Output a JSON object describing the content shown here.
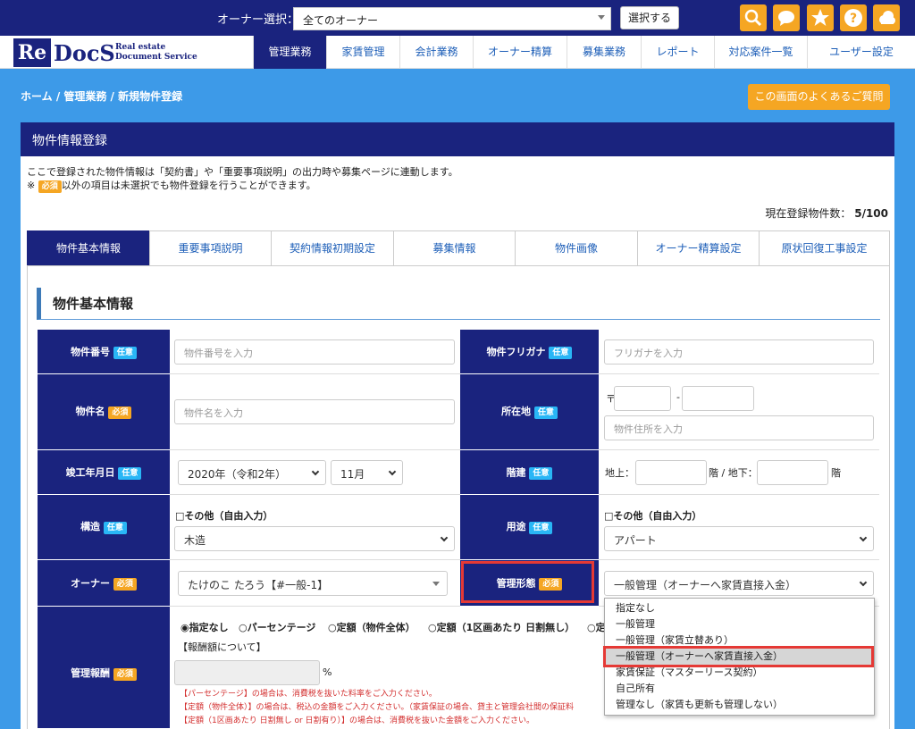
{
  "topbar": {
    "owner_label": "オーナー選択：",
    "owner_value": "全てのオーナー",
    "select_button": "選択する",
    "icons": [
      "search-icon",
      "chat-icon",
      "star-icon",
      "help-icon",
      "cloud-icon"
    ]
  },
  "logo": {
    "mark": "Re",
    "name": "DocS",
    "sub1": "Real estate",
    "sub2": "Document Service"
  },
  "nav": [
    "管理業務",
    "家賃管理",
    "会計業務",
    "オーナー精算",
    "募集業務",
    "レポート",
    "対応案件一覧",
    "ユーザー設定"
  ],
  "breadcrumb": "ホーム / 管理業務 / 新規物件登録",
  "faq_button": "この画面のよくあるご質問",
  "panel": {
    "title": "物件情報登録",
    "desc1": "ここで登録された物件情報は「契約書」や「重要事項説明」の出力時や募集ページに連動します。",
    "desc2_prefix": "※",
    "desc2_badge": "必須",
    "desc2_suffix": "以外の項目は未選択でも物件登録を行うことができます。",
    "count_label": "現在登録物件数：",
    "count_value": "5/100"
  },
  "tabs": [
    "物件基本情報",
    "重要事項説明",
    "契約情報初期設定",
    "募集情報",
    "物件画像",
    "オーナー精算設定",
    "原状回復工事設定"
  ],
  "section_title": "物件基本情報",
  "badges": {
    "required": "必須",
    "optional": "任意"
  },
  "fields": {
    "number": {
      "label": "物件番号",
      "placeholder": "物件番号を入力"
    },
    "kana": {
      "label": "物件フリガナ",
      "placeholder": "フリガナを入力"
    },
    "name": {
      "label": "物件名",
      "placeholder": "物件名を入力"
    },
    "address": {
      "label": "所在地",
      "postal_mark": "〒",
      "dash": "-",
      "placeholder": "物件住所を入力"
    },
    "built": {
      "label": "竣工年月日",
      "year": "2020年（令和2年）",
      "month": "11月"
    },
    "floors": {
      "label": "階建",
      "above": "地上：",
      "mid": "階 / 地下：",
      "end": "階"
    },
    "structure": {
      "label": "構造",
      "other": "□その他（自由入力）",
      "value": "木造"
    },
    "usage": {
      "label": "用途",
      "other": "□その他（自由入力）",
      "value": "アパート"
    },
    "owner": {
      "label": "オーナー",
      "value": "たけのこ たろう【#一般-1】"
    },
    "mgmt_type": {
      "label": "管理形態",
      "value": "一般管理（オーナーへ家賃直接入金）"
    },
    "fee": {
      "label": "管理報酬",
      "options": [
        "◉指定なし",
        "○パーセンテージ",
        "○定額（物件全体）",
        "○定額（1区画あたり 日割無し）",
        "○定"
      ],
      "note_label": "【報酬額について】",
      "unit": "%",
      "note1": "【パーセンテージ】の場合は、消費税を抜いた料率をご入力ください。",
      "note2": "【定額（物件全体）】の場合は、税込の金額をご入力ください。（家賃保証の場合、貸主と管理会社間の保証料",
      "note3": "【定額（1区画あたり 日割無し or 日割有り）】の場合は、消費税を抜いた金額をご入力ください。"
    }
  },
  "dropdown_options": [
    "指定なし",
    "一般管理",
    "一般管理（家賃立替あり）",
    "一般管理（オーナーへ家賃直接入金）",
    "家賃保証（マスターリース契約）",
    "自己所有",
    "管理なし（家賃も更新も管理しない）"
  ],
  "colors": {
    "navy": "#1a237e",
    "orange": "#f5a623",
    "sky": "#29b6f6",
    "highlight": "#e53935",
    "background": "#3d9ae8"
  }
}
